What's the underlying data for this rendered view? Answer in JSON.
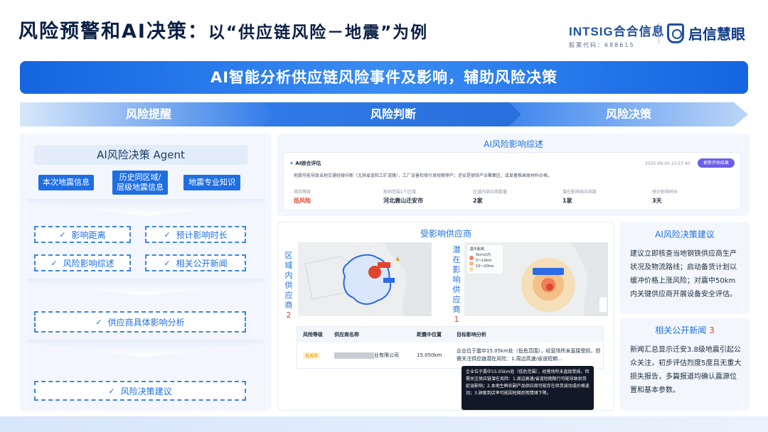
{
  "header": {
    "title_main": "风险预警和AI决策：",
    "title_sub": "以“供应链风险－地震”为例",
    "brand_intsig": "INTSIG合合信息",
    "brand_stock": "股票代码：688615",
    "brand_qixin": "启信慧眼"
  },
  "banner": {
    "text": "AI智能分析供应链风险事件及影响，辅助风险决策"
  },
  "steps": [
    "风险提醒",
    "风险判断",
    "风险决策"
  ],
  "left_panel": {
    "agent_title": "AI风险决策 Agent",
    "sources": [
      "本次地震信息",
      "历史同区域/层级地震信息",
      "地震专业知识"
    ],
    "analysis_items": [
      "影响距离",
      "预计影响时长",
      "风险影响综述",
      "相关公开新闻"
    ],
    "supplier_analysis": "供应商具体影响分析",
    "decision_advice": "风险决策建议",
    "check_mark": "✓"
  },
  "impact_summary": {
    "heading": "AI风险影响综述",
    "card_title": "AI综合评估",
    "timestamp": "2025-09-05 15:57:40",
    "re_evaluate_button": "更新评估结果",
    "description": "地震可能导致当地交通轻微中断（尤其省道和工矿道路），工厂设备检修引发短期停产；还安是钢铁产业聚集区，或显著推高原材料价格。",
    "metrics": [
      {
        "label": "风险等级",
        "value": "低风险"
      },
      {
        "label": "影响范围1个区域",
        "value": "河北唐山迁安市"
      },
      {
        "label": "区域内供应商数量",
        "value": "2家"
      },
      {
        "label": "潜在影响供应商数",
        "value": "1家"
      },
      {
        "label": "预计影响时长",
        "value": "3天"
      }
    ]
  },
  "supply_panel": {
    "heading": "受影响供应商",
    "left_vertical_label": "区域内供应商",
    "left_vertical_count": "2",
    "right_vertical_label": "潜在影响供应商",
    "right_vertical_count": "1",
    "map_legend": [
      "震中距离",
      "5km以内",
      "5～10km",
      "10～20km"
    ],
    "table": {
      "headers": [
        "风险等级",
        "供应商名称",
        "距震中位置",
        "目标影响分析"
      ],
      "rows": [
        {
          "level": "低风险",
          "name_suffix": "业有限公司",
          "distance": "15.050km",
          "analysis": "企业位于震中15.05km处（低危范围），经营场所未直接受损，但需关注供应链潜在风险：1.周边高速/省道短期..."
        }
      ]
    },
    "tooltip": "企业位于震中15.05km处（低危范围），经营场所未直接受损，但需关注供应链潜在风险：1.周边高速/省道短期限行可能导致供货延误影响；2.本地生鲜农副产品供应商可能存在供货波动或价格波动；3.顾客到店率可能因短期恐慌情绪下降。"
  },
  "advice_card": {
    "heading": "AI风险决策建议",
    "body": "建议立即核查当地钢铁供应商生产状况及物流路线；启动备货计划以缓冲价格上涨风险；对震中50km内关键供应商开展设备安全评估。"
  },
  "news_card": {
    "heading": "相关公开新闻",
    "count": "3",
    "body": "新闻汇总显示迁安3.8级地震引起公众关注，初步评估烈度5度且无重大损失报告，多篇报道均确认震源位置和基本参数。"
  },
  "colors": {
    "primary": "#1f6fe3",
    "danger": "#e0452c",
    "navy": "#0a1f44"
  }
}
